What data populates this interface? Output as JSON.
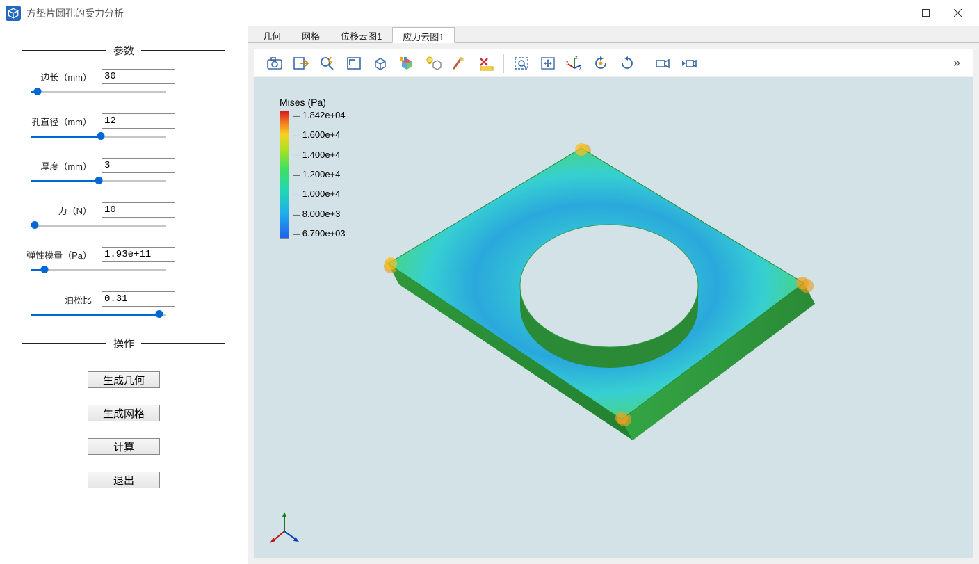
{
  "window": {
    "title": "方垫片圆孔的受力分析"
  },
  "sidebar": {
    "params_header": "参数",
    "actions_header": "操作",
    "params": [
      {
        "label": "边长（mm）",
        "value": "30",
        "slider_pct": 5
      },
      {
        "label": "孔直径（mm）",
        "value": "12",
        "slider_pct": 52
      },
      {
        "label": "厚度（mm）",
        "value": "3",
        "slider_pct": 50
      },
      {
        "label": "力（N）",
        "value": "10",
        "slider_pct": 3
      },
      {
        "label": "弹性模量（Pa）",
        "value": "1.93e+11",
        "slider_pct": 10
      },
      {
        "label": "泊松比",
        "value": "0.31",
        "slider_pct": 95
      }
    ],
    "actions": [
      {
        "label": "生成几何"
      },
      {
        "label": "生成网格"
      },
      {
        "label": "计算"
      },
      {
        "label": "退出"
      }
    ]
  },
  "tabs": {
    "items": [
      {
        "label": "几何",
        "active": false
      },
      {
        "label": "网格",
        "active": false
      },
      {
        "label": "位移云图1",
        "active": false
      },
      {
        "label": "应力云图1",
        "active": true
      }
    ]
  },
  "toolbar_icons": [
    "camera-icon",
    "export-icon",
    "zoom-lightning-icon",
    "fit-corner-icon",
    "box3d-icon",
    "cube-colors-icon",
    "lightbulb-cube-icon",
    "brush-icon",
    "x-ruler-icon",
    "SEP",
    "marquee-zoom-icon",
    "expand-arrows-icon",
    "axes-icon",
    "rotate-left-icon",
    "rotate-right-icon",
    "SEP",
    "camera-side-icon",
    "camera-rewind-icon"
  ],
  "legend": {
    "title": "Mises (Pa)",
    "ticks": [
      "1.842e+04",
      "1.600e+4",
      "1.400e+4",
      "1.200e+4",
      "1.000e+4",
      "8.000e+3",
      "6.790e+03"
    ]
  }
}
